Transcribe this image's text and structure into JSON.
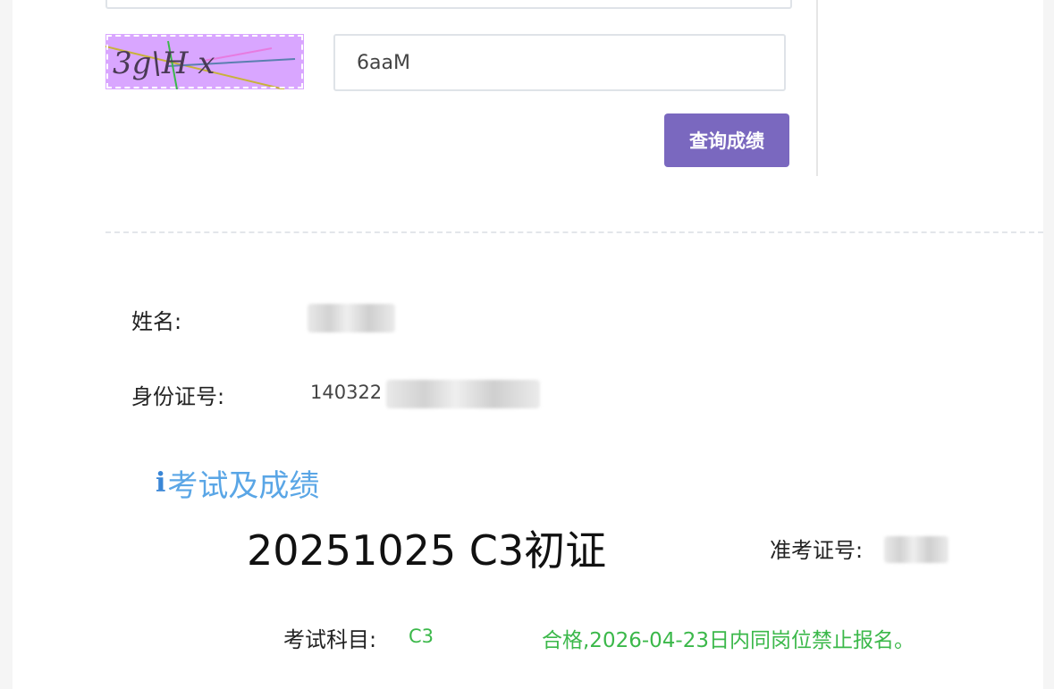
{
  "captcha": {
    "image_text": "3g\\H x",
    "input_value": "6aaM",
    "background_color": "#d9a6ff"
  },
  "actions": {
    "query_button_label": "查询成绩",
    "button_color": "#7a68bf"
  },
  "profile": {
    "name_label": "姓名:",
    "id_label": "身份证号:",
    "id_prefix": "140322"
  },
  "section": {
    "icon": "info-icon",
    "icon_glyph": "i",
    "title": "考试及成绩",
    "title_color": "#5aa6e6"
  },
  "exam": {
    "name": "20251025 C3初证",
    "ticket_label": "准考证号:",
    "subject_label": "考试科目:",
    "subject_value": "C3",
    "result_text": "合格,2026-04-23日内同岗位禁止报名。",
    "result_color": "#3bb84a"
  }
}
